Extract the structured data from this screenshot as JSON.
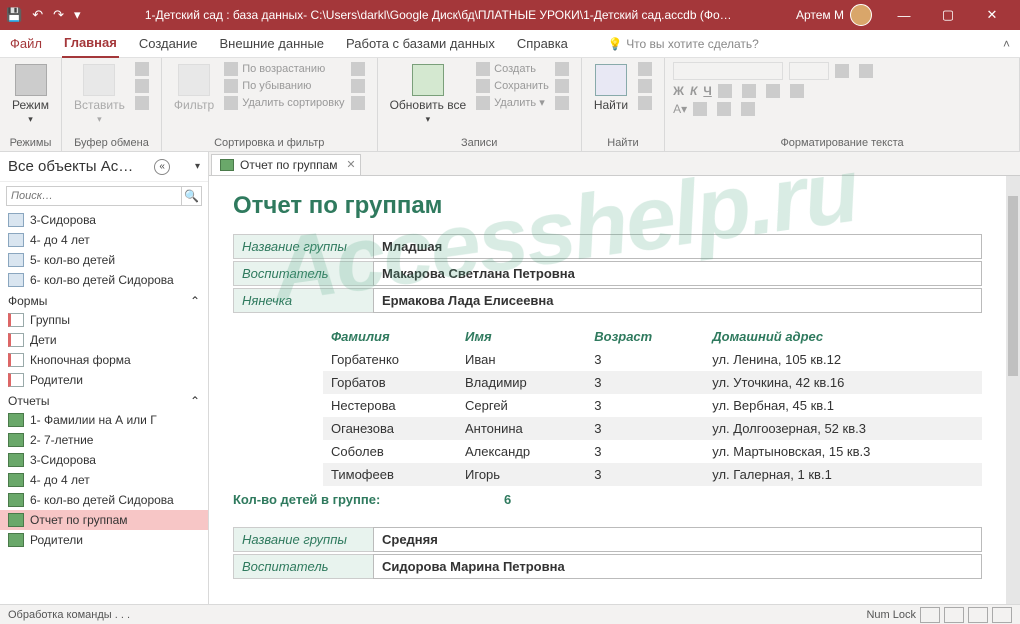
{
  "titlebar": {
    "app_title": "1-Детский сад : база данных- C:\\Users\\darkl\\Google Диск\\бд\\ПЛАТНЫЕ УРОКИ\\1-Детский сад.accdb (Фо…",
    "user": "Артем М"
  },
  "ribbon_tabs": {
    "file": "Файл",
    "home": "Главная",
    "create": "Создание",
    "external": "Внешние данные",
    "dbtools": "Работа с базами данных",
    "help": "Справка",
    "tell_me": "Что вы хотите сделать?"
  },
  "ribbon_groups": {
    "views": {
      "label": "Режимы",
      "btn": "Режим"
    },
    "clipboard": {
      "label": "Буфер обмена",
      "btn": "Вставить"
    },
    "sort": {
      "label": "Сортировка и фильтр",
      "btn": "Фильтр",
      "asc": "По возрастанию",
      "desc": "По убыванию",
      "clear": "Удалить сортировку"
    },
    "records": {
      "label": "Записи",
      "btn": "Обновить все",
      "new": "Создать",
      "save": "Сохранить",
      "delete": "Удалить"
    },
    "find": {
      "label": "Найти",
      "btn": "Найти"
    },
    "format": {
      "label": "Форматирование текста"
    }
  },
  "nav": {
    "title": "Все объекты Ac…",
    "search_placeholder": "Поиск…",
    "queries": [
      "3-Сидорова",
      "4- до 4 лет",
      "5- кол-во детей",
      "6- кол-во детей Сидорова"
    ],
    "forms_label": "Формы",
    "forms": [
      "Группы",
      "Дети",
      "Кнопочная форма",
      "Родители"
    ],
    "reports_label": "Отчеты",
    "reports": [
      "1- Фамилии на А или Г",
      "2- 7-летние",
      "3-Сидорова",
      "4- до 4 лет",
      "6- кол-во детей Сидорова",
      "Отчет по группам",
      "Родители"
    ],
    "selected_report": "Отчет по группам"
  },
  "tab": {
    "title": "Отчет по группам"
  },
  "report": {
    "title": "Отчет по группам",
    "labels": {
      "group_name": "Название группы",
      "educator": "Воспитатель",
      "nanny": "Нянечка",
      "col_surname": "Фамилия",
      "col_name": "Имя",
      "col_age": "Возраст",
      "col_addr": "Домашний адрес",
      "count": "Кол-во детей в группе:"
    },
    "group1": {
      "name": "Младшая",
      "educator": "Макарова Светлана Петровна",
      "nanny": "Ермакова Лада Елисеевна",
      "rows": [
        {
          "s": "Горбатенко",
          "n": "Иван",
          "a": "3",
          "addr": "ул. Ленина, 105 кв.12"
        },
        {
          "s": "Горбатов",
          "n": "Владимир",
          "a": "3",
          "addr": "ул. Уточкина, 42 кв.16"
        },
        {
          "s": "Нестерова",
          "n": "Сергей",
          "a": "3",
          "addr": "ул. Вербная, 45 кв.1"
        },
        {
          "s": "Оганезова",
          "n": "Антонина",
          "a": "3",
          "addr": "ул. Долгоозерная, 52 кв.3"
        },
        {
          "s": "Соболев",
          "n": "Александр",
          "a": "3",
          "addr": "ул. Мартыновская, 15 кв.3"
        },
        {
          "s": "Тимофеев",
          "n": "Игорь",
          "a": "3",
          "addr": "ул. Галерная, 1 кв.1"
        }
      ],
      "count": "6"
    },
    "group2": {
      "name": "Средняя",
      "educator": "Сидорова Марина Петровна"
    }
  },
  "statusbar": {
    "msg": "Обработка команды . . .",
    "numlock": "Num Lock"
  },
  "watermark": "Accesshelp.ru"
}
